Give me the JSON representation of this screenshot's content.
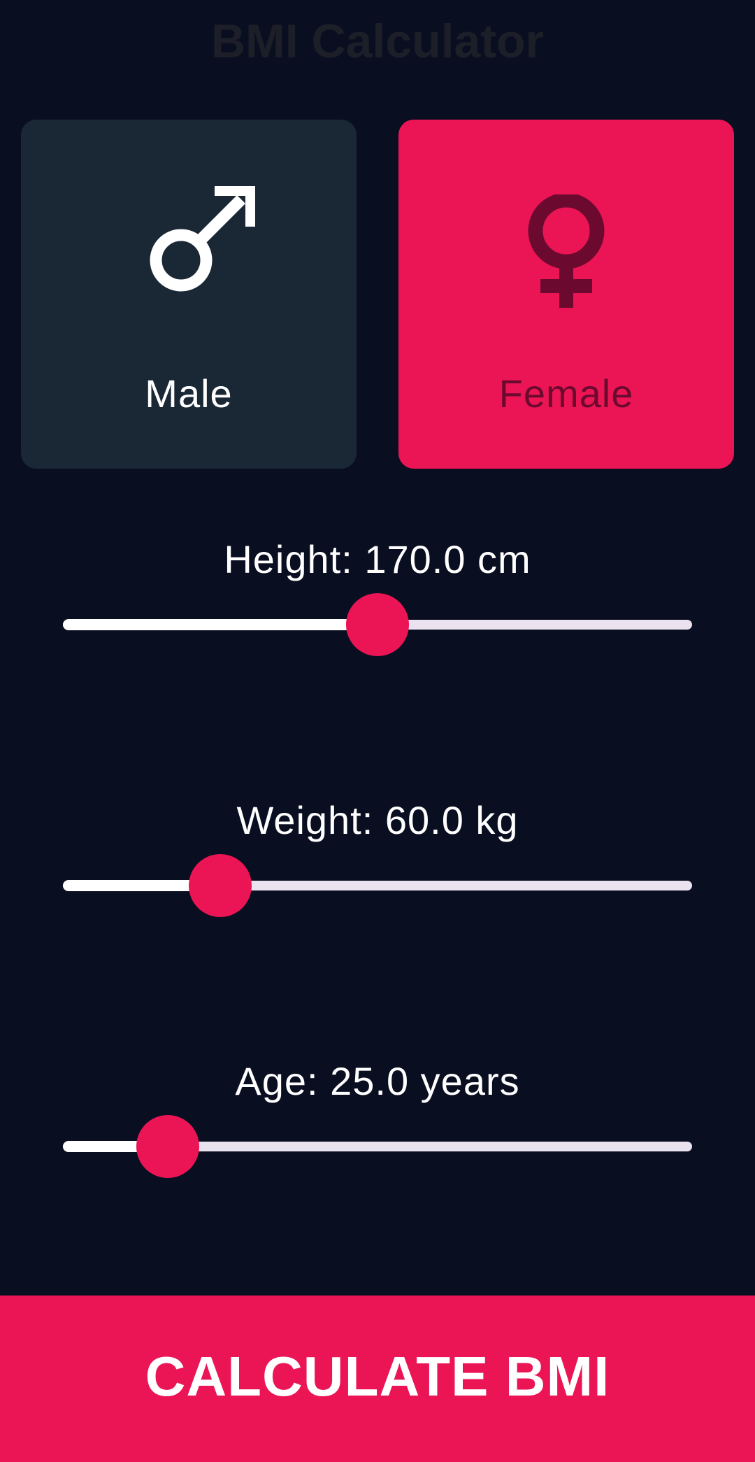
{
  "app": {
    "title": "BMI Calculator"
  },
  "gender": {
    "selected": "female",
    "male": {
      "label": "Male",
      "icon": "male-symbol-icon"
    },
    "female": {
      "label": "Female",
      "icon": "female-symbol-icon"
    }
  },
  "sliders": {
    "height": {
      "label": "Height: 170.0 cm",
      "fraction": 0.5
    },
    "weight": {
      "label": "Weight: 60.0 kg",
      "fraction": 0.25
    },
    "age": {
      "label": "Age: 25.0 years",
      "fraction": 0.167
    }
  },
  "button": {
    "label": "CALCULATE BMI"
  },
  "colors": {
    "background": "#0a0e21",
    "card_inactive": "#1a2735",
    "accent": "#eb1555",
    "female_text": "#6b0a2e"
  }
}
